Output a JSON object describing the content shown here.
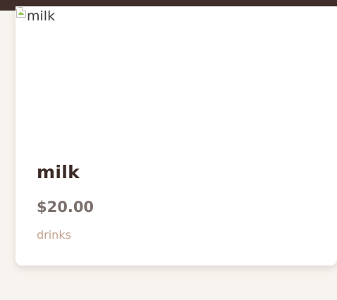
{
  "product": {
    "image_alt": "milk",
    "name": "milk",
    "price": "$20.00",
    "category": "drinks"
  },
  "icons": {
    "broken_image": "broken-image-icon"
  },
  "colors": {
    "header": "#3f2e2a",
    "page_background": "#f7f3ee",
    "card_background": "#ffffff",
    "name": "#3c2c27",
    "price": "#7c706c",
    "category": "#c3a48f"
  }
}
